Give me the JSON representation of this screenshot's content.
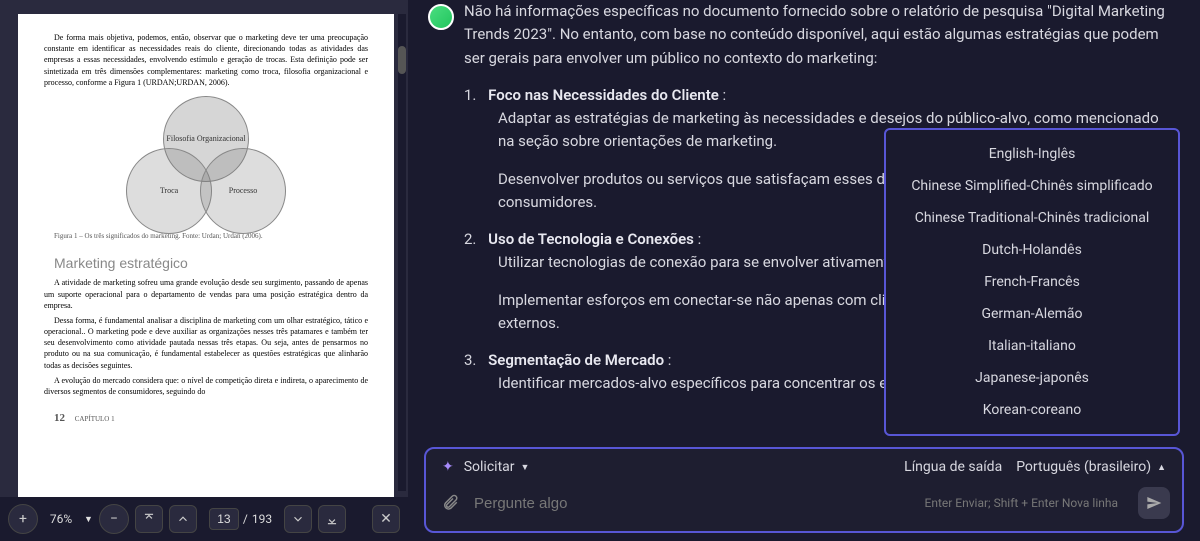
{
  "pdf": {
    "para1": "De forma mais objetiva, podemos, então, observar que o marketing deve ter uma preocupação constante em identificar as necessidades reais do cliente, direcionando todas as atividades das empresas a essas necessidades, envolvendo estímulo e geração de trocas. Esta definição pode ser sintetizada em três dimensões complementares: marketing como troca, filosofia organizacional e processo, conforme a Figura 1 (URDAN;URDAN, 2006).",
    "venn": {
      "top": "Filosofia Organizacional",
      "left": "Troca",
      "right": "Processo"
    },
    "fig_caption": "Figura 1 – Os três significados do marketing. Fonte: Urdan; Urdan (2006).",
    "section": "Marketing estratégico",
    "para2": "A atividade de marketing sofreu uma grande evolução desde seu surgimento, passando de apenas um suporte operacional para o departamento de vendas para uma posição estratégica dentro da empresa.",
    "para3": "Dessa forma, é fundamental analisar a disciplina de marketing com um olhar estratégico, tático e operacional.. O marketing pode e deve auxiliar as organizações nesses três patamares e também ter seu desenvolvimento como atividade pautada nessas três etapas. Ou seja, antes de pensarmos no produto ou na sua comunicação, é fundamental estabelecer as questões estratégicas que alinharão todas as decisões seguintes.",
    "para4": "A evolução do mercado considera que: o nível de competição direta e indireta, o aparecimento de diversos segmentos de consumidores, seguindo do",
    "page_num": "12",
    "chapter": "CAPÍTULO 1"
  },
  "toolbar": {
    "zoom": "76%",
    "current_page": "13",
    "page_sep": "/",
    "total_pages": "193"
  },
  "chat": {
    "intro": "Não há informações específicas no documento fornecido sobre o relatório de pesquisa \"Digital Marketing Trends 2023\". No entanto, com base no conteúdo disponível, aqui estão algumas estratégias que podem ser gerais para envolver um público no contexto do marketing:",
    "items": [
      {
        "num": "1.",
        "title": "Foco nas Necessidades do Cliente",
        "colon": " :",
        "subs": [
          "Adaptar as estratégias de marketing às necessidades e desejos do público-alvo, como mencionado na seção sobre orientações de marketing.",
          "Desenvolver produtos ou serviços que satisfaçam esses desejos, criando uma conexão forte com os consumidores."
        ]
      },
      {
        "num": "2.",
        "title": "Uso de Tecnologia e Conexões",
        "colon": " :",
        "subs": [
          "Utilizar tecnologias de conexão para se envolver ativamente com o público.",
          "Implementar esforços em conectar-se não apenas com clientes, mas também com parceiros externos."
        ]
      },
      {
        "num": "3.",
        "title": "Segmentação de Mercado",
        "colon": " :",
        "subs": [
          "Identificar mercados-alvo específicos para concentrar os esforços de marketing."
        ]
      }
    ]
  },
  "lang_menu": [
    "English-Inglês",
    "Chinese Simplified-Chinês simplificado",
    "Chinese Traditional-Chinês tradicional",
    "Dutch-Holandês",
    "French-Francês",
    "German-Alemão",
    "Italian-italiano",
    "Japanese-japonês",
    "Korean-coreano"
  ],
  "input": {
    "solicit": "Solicitar",
    "out_label": "Língua de saída",
    "out_value": "Português (brasileiro)",
    "placeholder": "Pergunte algo",
    "hint": "Enter Enviar; Shift + Enter Nova linha"
  }
}
